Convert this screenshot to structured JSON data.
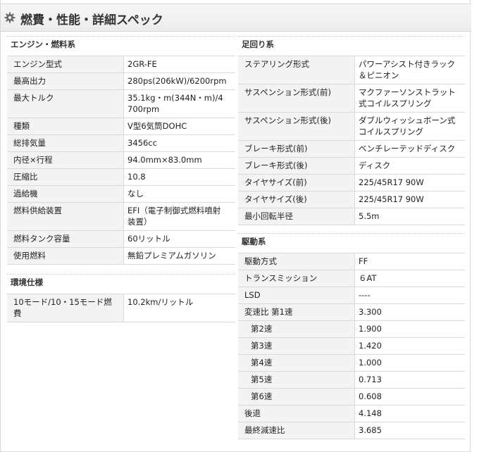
{
  "page": {
    "title": "燃費・性能・詳細スペック"
  },
  "engine": {
    "title": "エンジン・燃料系",
    "rows": [
      {
        "label": "エンジン型式",
        "value": [
          "2GR-FE"
        ]
      },
      {
        "label": "最高出力",
        "value": [
          "280ps(206kW)/6200rpm"
        ]
      },
      {
        "label": "最大トルク",
        "value": [
          "35.1kg・m(344N・m)/4",
          "700rpm"
        ]
      },
      {
        "label": "種類",
        "value": [
          "V型6気筒DOHC"
        ]
      },
      {
        "label": "総排気量",
        "value": [
          "3456cc"
        ]
      },
      {
        "label": "内径×行程",
        "value": [
          "94.0mm×83.0mm"
        ]
      },
      {
        "label": "圧縮比",
        "value": [
          "10.8"
        ]
      },
      {
        "label": "過給機",
        "value": [
          "なし"
        ]
      },
      {
        "label": "燃料供給装置",
        "value": [
          "EFI（電子制御式燃料噴射",
          "装置）"
        ]
      },
      {
        "label": "燃料タンク容量",
        "value": [
          "60リットル"
        ]
      },
      {
        "label": "使用燃料",
        "value": [
          "無鉛プレミアムガソリン"
        ]
      }
    ]
  },
  "environment": {
    "title": "環境仕様",
    "rows": [
      {
        "label": [
          "10モード/10・15モード燃",
          "費"
        ],
        "value": [
          "10.2km/リットル"
        ]
      }
    ]
  },
  "suspension": {
    "title": "足回り系",
    "rows": [
      {
        "label": "ステアリング形式",
        "value": [
          "パワーアシスト付きラック",
          "＆ピニオン"
        ]
      },
      {
        "label": "サスペンション形式(前)",
        "value": [
          "マクファーソンストラット",
          "式コイルスプリング"
        ]
      },
      {
        "label": "サスペンション形式(後)",
        "value": [
          "ダブルウィッシュボーン式",
          "コイルスプリング"
        ]
      },
      {
        "label": "ブレーキ形式(前)",
        "value": [
          "ベンチレーテッドディスク"
        ]
      },
      {
        "label": "ブレーキ形式(後)",
        "value": [
          "ディスク"
        ]
      },
      {
        "label": "タイヤサイズ(前)",
        "value": [
          "225/45R17 90W"
        ]
      },
      {
        "label": "タイヤサイズ(後)",
        "value": [
          "225/45R17 90W"
        ]
      },
      {
        "label": "最小回転半径",
        "value": [
          "5.5m"
        ]
      }
    ]
  },
  "drivetrain": {
    "title": "駆動系",
    "rows": [
      {
        "label": "駆動方式",
        "value": [
          "FF"
        ]
      },
      {
        "label": "トランスミッション",
        "value": [
          "６AT"
        ]
      },
      {
        "label": "LSD",
        "value": [
          "----"
        ]
      },
      {
        "label": "変速比 第1速",
        "value": [
          "3.300"
        ]
      },
      {
        "label": "第2速",
        "value": [
          "1.900"
        ],
        "indent": true
      },
      {
        "label": "第3速",
        "value": [
          "1.420"
        ],
        "indent": true
      },
      {
        "label": "第4速",
        "value": [
          "1.000"
        ],
        "indent": true
      },
      {
        "label": "第5速",
        "value": [
          "0.713"
        ],
        "indent": true
      },
      {
        "label": "第6速",
        "value": [
          "0.608"
        ],
        "indent": true
      },
      {
        "label": "後退",
        "value": [
          "4.148"
        ]
      },
      {
        "label": "最終減速比",
        "value": [
          "3.685"
        ]
      }
    ]
  }
}
